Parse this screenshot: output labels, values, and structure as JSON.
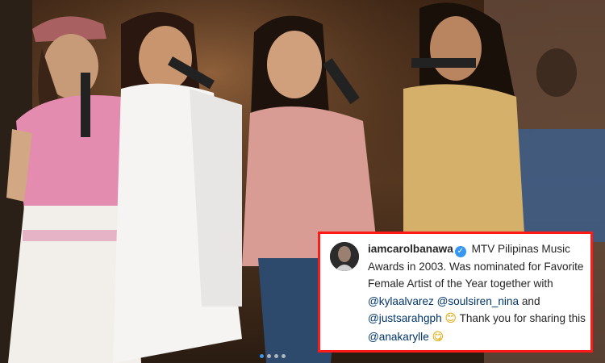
{
  "caption": {
    "username": "iamcarolbanawa",
    "verified_icon": "verified-badge-icon",
    "text_before": "MTV Pilipinas Music Awards in 2003. Was nominated for Favorite Female Artist of the Year together with",
    "mention_1": "@kylaalvarez",
    "mention_2": "@soulsiren_nina",
    "and": "and",
    "mention_3": "@justsarahgph",
    "emoji_1": "😊",
    "thanks": "Thank you for sharing this",
    "mention_4": "@anakarylle",
    "emoji_2": "😋"
  },
  "colors": {
    "card_border": "#ff1a1a",
    "mention": "#003569",
    "verified": "#3897f0"
  },
  "carousel": {
    "dot_count": 4,
    "active_index": 0
  }
}
